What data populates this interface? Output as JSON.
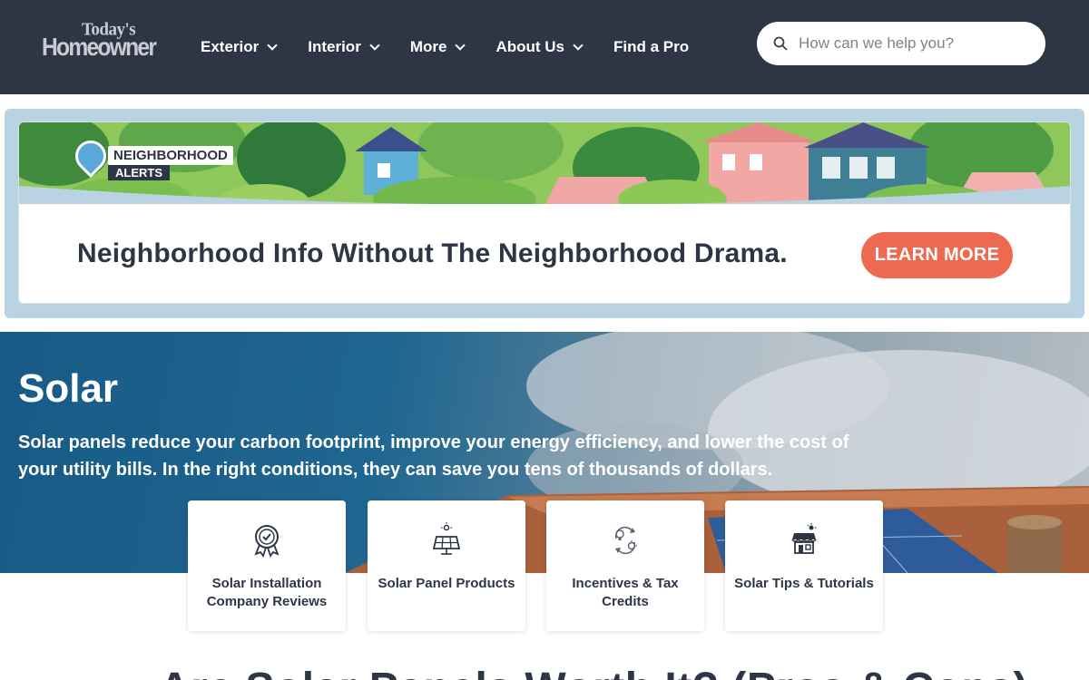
{
  "header": {
    "logo_line1": "Today's",
    "logo_line2": "Homeowner",
    "nav": [
      {
        "label": "Exterior",
        "has_dropdown": true
      },
      {
        "label": "Interior",
        "has_dropdown": true
      },
      {
        "label": "More",
        "has_dropdown": true
      },
      {
        "label": "About Us",
        "has_dropdown": true
      },
      {
        "label": "Find a Pro",
        "has_dropdown": false
      }
    ],
    "search_placeholder": "How can we help you?",
    "search_icon": "search-icon"
  },
  "ad": {
    "badge_line1": "NEIGHBORHOOD",
    "badge_line2": "ALERTS",
    "headline": "Neighborhood Info Without The Neighborhood Drama.",
    "cta": "LEARN MORE"
  },
  "hero": {
    "title": "Solar",
    "description": "Solar panels reduce your carbon footprint, improve your energy efficiency, and lower the cost of your utility bills. In the right conditions, they can save you tens of thousands of dollars."
  },
  "categories": [
    {
      "label": "Solar Installation Company Reviews",
      "icon": "award-badge-icon"
    },
    {
      "label": "Solar Panel Products",
      "icon": "solar-panel-icon"
    },
    {
      "label": "Incentives & Tax Credits",
      "icon": "lightbulb-cycle-icon"
    },
    {
      "label": "Solar Tips & Tutorials",
      "icon": "storefront-icon"
    }
  ],
  "article_heading": "Are Solar Panels Worth It? (Pros & Cons)",
  "colors": {
    "header_bg": "#2e3646",
    "ad_border": "#b9d3e3",
    "cta": "#ed6a50",
    "hero_blue": "#175a86"
  }
}
